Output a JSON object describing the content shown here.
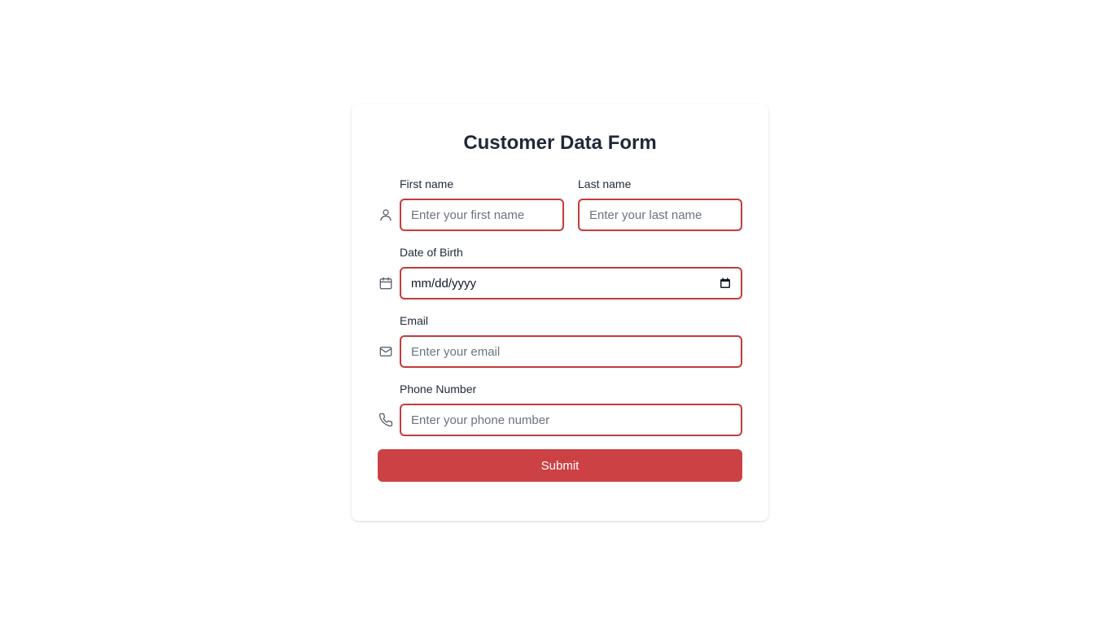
{
  "form": {
    "title": "Customer Data Form",
    "first_name": {
      "label": "First name",
      "placeholder": "Enter your first name",
      "value": ""
    },
    "last_name": {
      "label": "Last name",
      "placeholder": "Enter your last name",
      "value": ""
    },
    "dob": {
      "label": "Date of Birth",
      "display": "mm/dd/yyyy"
    },
    "email": {
      "label": "Email",
      "placeholder": "Enter your email",
      "value": ""
    },
    "phone": {
      "label": "Phone Number",
      "placeholder": "Enter your phone number",
      "value": ""
    },
    "submit_label": "Submit"
  },
  "icons": {
    "name_row": "user-icon",
    "dob_row": "calendar-icon",
    "email_row": "mail-icon",
    "phone_row": "phone-icon",
    "date_picker": "calendar-picker-icon"
  },
  "colors": {
    "accent": "#cc4143",
    "input_border": "#c53b3b",
    "text": "#1f2937",
    "placeholder": "#6b7280",
    "icon": "#4b5563"
  }
}
